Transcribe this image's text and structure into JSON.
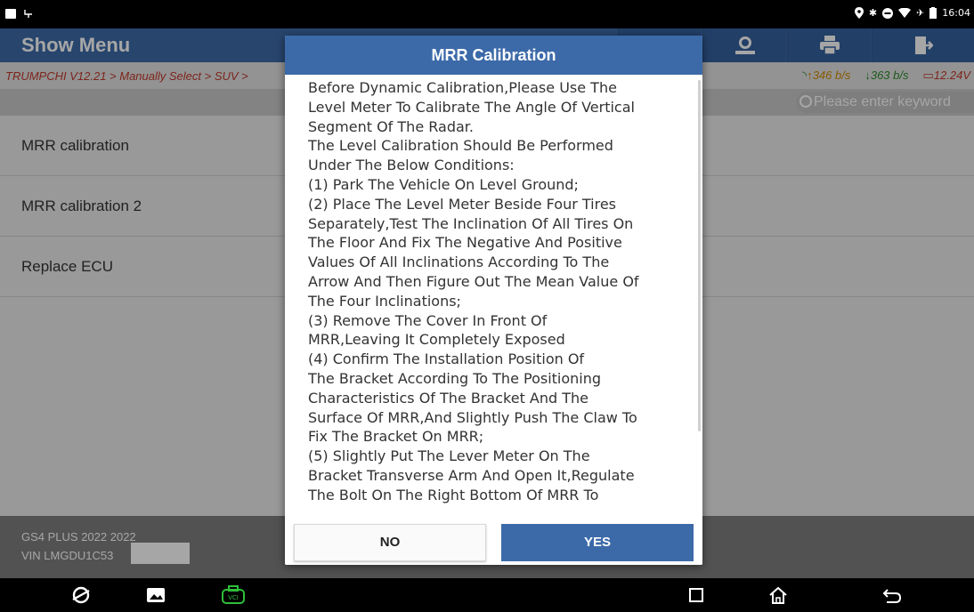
{
  "status_bar": {
    "left_icons": [
      "image-icon",
      "usb-icon"
    ],
    "right_icons": [
      "location-icon",
      "bluetooth-icon",
      "dnd-icon",
      "wifi-icon",
      "airplane-icon",
      "battery-icon"
    ],
    "time": "16:04"
  },
  "header": {
    "title": "Show Menu",
    "toolbar_icons": [
      "print-icon",
      "exit-icon"
    ],
    "partial_icons": [
      "user-icon"
    ]
  },
  "breadcrumb": {
    "text": "TRUMPCHI V12.21 > Manually Select > SUV >",
    "upload": "346 b/s",
    "download": "363 b/s",
    "voltage": "12.24V"
  },
  "search": {
    "placeholder": "Please enter keyword"
  },
  "menu": {
    "items": [
      {
        "label": "MRR calibration"
      },
      {
        "label": "MRR calibration 2"
      },
      {
        "label": "Replace ECU"
      }
    ]
  },
  "footer": {
    "model": "GS4 PLUS 2022 2022",
    "vin": "VIN LMGDU1C53"
  },
  "dialog": {
    "title": "MRR Calibration",
    "body": "Before Dynamic Calibration,Please Use The\nLevel Meter To Calibrate The Angle Of Vertical\nSegment Of The Radar.\n The Level Calibration Should Be Performed\nUnder The Below Conditions:\n(1) Park The Vehicle On Level Ground;\n(2) Place The Level Meter Beside Four Tires\nSeparately,Test The Inclination Of All Tires On\nThe Floor And Fix The Negative And Positive\nValues Of All Inclinations According To The\nArrow And Then Figure Out The Mean Value Of\nThe Four Inclinations;\n(3) Remove The Cover In Front Of\nMRR,Leaving It Completely Exposed\n(4) Confirm The Installation Position Of\nThe Bracket According To The Positioning\nCharacteristics Of The Bracket And The\nSurface Of MRR,And Slightly Push The Claw To\nFix The Bracket On MRR;\n(5) Slightly Put The Lever Meter On The\nBracket Transverse Arm And Open It,Regulate\nThe Bolt On The Right Bottom Of MRR To",
    "no_label": "NO",
    "yes_label": "YES"
  },
  "navbar": {
    "icons": [
      "browser-icon",
      "gallery-icon",
      "vci-icon",
      "recent-apps-icon",
      "home-icon",
      "back-icon"
    ]
  },
  "colors": {
    "primary": "#3c6aa8",
    "breadcrumb_text": "#c0392b",
    "upload": "#d08a00",
    "download": "#2a8a2a"
  }
}
